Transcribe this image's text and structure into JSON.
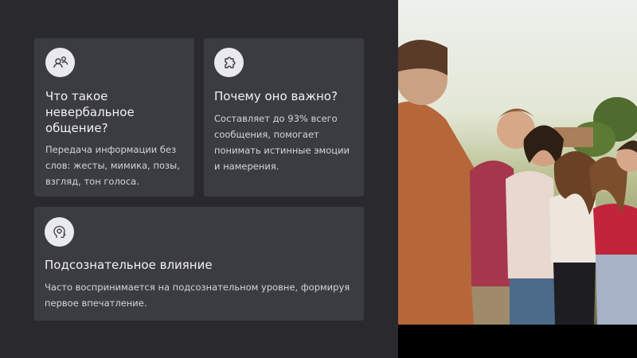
{
  "cards": [
    {
      "icon": "people-icon",
      "title": "Что такое невербальное общение?",
      "text": "Передача информации без слов: жесты, мимика, позы, взгляд, тон голоса."
    },
    {
      "icon": "puzzle-icon",
      "title": "Почему оно важно?",
      "text": "Составляет до 93% всего сообщения, помогает понимать истинные эмоции и намерения."
    },
    {
      "icon": "brain-head-icon",
      "title": "Подсознательное влияние",
      "text": "Часто воспринимается на подсознательном уровне, формируя первое впечатление."
    }
  ],
  "photo": {
    "subject": "group-of-smiling-young-people-photo"
  }
}
